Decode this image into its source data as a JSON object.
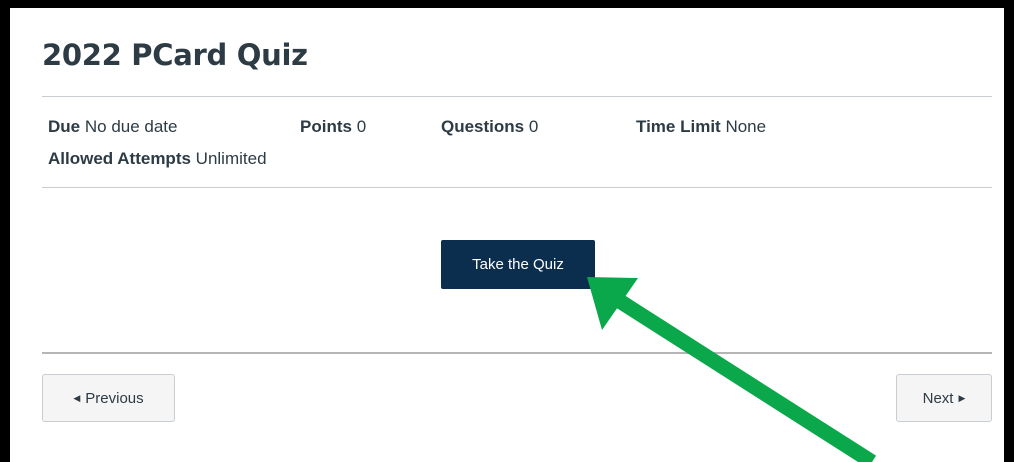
{
  "quiz": {
    "title": "2022 PCard Quiz",
    "details": {
      "due_label": "Due",
      "due_value": "No due date",
      "points_label": "Points",
      "points_value": "0",
      "questions_label": "Questions",
      "questions_value": "0",
      "time_limit_label": "Time Limit",
      "time_limit_value": "None",
      "attempts_label": "Allowed Attempts",
      "attempts_value": "Unlimited"
    },
    "take_button_label": "Take the Quiz"
  },
  "navigation": {
    "previous_label": "Previous",
    "next_label": "Next",
    "previous_icon": "triangle-left-icon",
    "next_icon": "triangle-right-icon"
  },
  "annotation": {
    "arrow_color": "#0aa84a",
    "accent_button_color": "#0b2d4e"
  }
}
